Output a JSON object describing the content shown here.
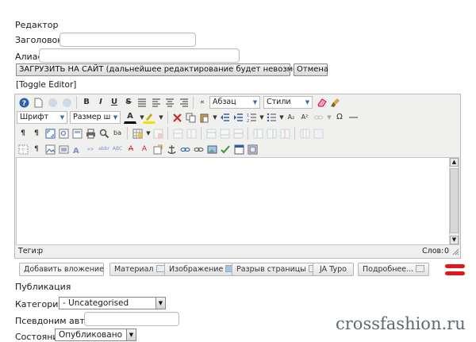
{
  "section_title": "Редактор",
  "form": {
    "title_label": "Заголовок *",
    "title_value": "",
    "alias_label": "Алиас",
    "alias_value": "",
    "upload_button": "ЗАГРУЗИТЬ НА САЙТ (дальнейшее редактирование будет невозможно)",
    "cancel_button": "Отмена",
    "toggle_editor": "[Toggle Editor]"
  },
  "toolbar": {
    "row1": {
      "format_paragraph": "Абзац",
      "styles": "Стили",
      "bold": "B",
      "italic": "I",
      "underline": "U",
      "strike": "S"
    },
    "row2": {
      "font_family": "Шрифт",
      "font_size": "Размер шрифта",
      "font_color": "A",
      "omega": "Ω"
    }
  },
  "status": {
    "path_label": "Теги:",
    "path_value": "p",
    "words_label": "Слов:",
    "words_value": "0"
  },
  "extra_buttons": {
    "add_attachment": "Добавить вложение",
    "material": "Материал",
    "image": "Изображение",
    "page_break": "Разрыв страницы",
    "ja_typo": "JA Typo",
    "read_more": "Подробнее..."
  },
  "publishing": {
    "title": "Публикация",
    "category_label": "Категория *",
    "category_value": "- Uncategorised",
    "author_alias_label": "Псевдоним автора",
    "author_alias_value": "",
    "state_label": "Состояние",
    "state_value": "Опубликовано"
  },
  "watermark": "crossfashion.ru",
  "colors": {
    "accent_red": "#e01a1a",
    "icon_blue": "#2f5fa8",
    "watermark": "#5b6a74"
  }
}
